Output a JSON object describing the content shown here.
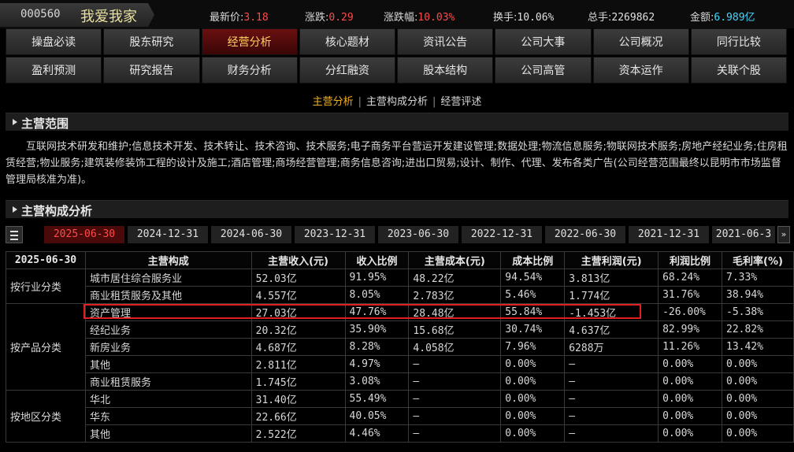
{
  "stock": {
    "code": "000560",
    "name": "我爱我家",
    "quotes": [
      {
        "label": "最新价:",
        "value": "3.18",
        "color": "red"
      },
      {
        "label": "涨跌:",
        "value": "0.29",
        "color": "red"
      },
      {
        "label": "涨跌幅:",
        "value": "10.03%",
        "color": "red"
      },
      {
        "label": "换手:",
        "value": "10.06%",
        "color": "wht"
      },
      {
        "label": "总手:",
        "value": "2269862",
        "color": "wht"
      },
      {
        "label": "金额:",
        "value": "6.989亿",
        "color": "cyan"
      }
    ]
  },
  "nav": {
    "row1": [
      "操盘必读",
      "股东研究",
      "经营分析",
      "核心题材",
      "资讯公告",
      "公司大事",
      "公司概况",
      "同行比较"
    ],
    "row2": [
      "盈利预测",
      "研究报告",
      "财务分析",
      "分红融资",
      "股本结构",
      "公司高管",
      "资本运作",
      "关联个股"
    ],
    "active": "经营分析"
  },
  "subnav": {
    "items": [
      "主营分析",
      "主营构成分析",
      "经营评述"
    ],
    "selected": "主营分析"
  },
  "section_scope": {
    "title": "主营范围",
    "text": "互联网技术研发和维护;信息技术开发、技术转让、技术咨询、技术服务;电子商务平台营运开发建设管理;数据处理;物流信息服务;物联网技术服务;房地产经纪业务;住房租赁经营;物业服务;建筑装修装饰工程的设计及施工;酒店管理;商场经营管理;商务信息咨询;进出口贸易;设计、制作、代理、发布各类广告(公司经营范围最终以昆明市市场监督管理局核准为准)。"
  },
  "section_comp": {
    "title": "主营构成分析"
  },
  "date_tabs": [
    "2025-06-30",
    "2024-12-31",
    "2024-06-30",
    "2023-12-31",
    "2023-06-30",
    "2022-12-31",
    "2022-06-30",
    "2021-12-31",
    "2021-06-3"
  ],
  "date_active": "2025-06-30",
  "more_glyph": "»",
  "table": {
    "headers": [
      "2025-06-30",
      "主营构成",
      "主营收入(元)",
      "收入比例",
      "主营成本(元)",
      "成本比例",
      "主营利润(元)",
      "利润比例",
      "毛利率(%)"
    ],
    "groups": [
      {
        "category": "按行业分类",
        "rows": [
          [
            "城市居住综合服务业",
            "52.03亿",
            "91.95%",
            "48.22亿",
            "94.54%",
            "3.813亿",
            "68.24%",
            "7.33%"
          ],
          [
            "商业租赁服务及其他",
            "4.557亿",
            "8.05%",
            "2.783亿",
            "5.46%",
            "1.774亿",
            "31.76%",
            "38.94%"
          ]
        ]
      },
      {
        "category": "按产品分类",
        "rows": [
          [
            "资产管理",
            "27.03亿",
            "47.76%",
            "28.48亿",
            "55.84%",
            "-1.453亿",
            "-26.00%",
            "-5.38%"
          ],
          [
            "经纪业务",
            "20.32亿",
            "35.90%",
            "15.68亿",
            "30.74%",
            "4.637亿",
            "82.99%",
            "22.82%"
          ],
          [
            "新房业务",
            "4.687亿",
            "8.28%",
            "4.058亿",
            "7.96%",
            "6288万",
            "11.26%",
            "13.42%"
          ],
          [
            "其他",
            "2.811亿",
            "4.97%",
            "—",
            "0.00%",
            "—",
            "0.00%",
            "0.00%"
          ],
          [
            "商业租赁服务",
            "1.745亿",
            "3.08%",
            "—",
            "0.00%",
            "—",
            "0.00%",
            "0.00%"
          ]
        ]
      },
      {
        "category": "按地区分类",
        "rows": [
          [
            "华北",
            "31.40亿",
            "55.49%",
            "—",
            "0.00%",
            "—",
            "0.00%",
            "0.00%"
          ],
          [
            "华东",
            "22.66亿",
            "40.05%",
            "—",
            "0.00%",
            "—",
            "0.00%",
            "0.00%"
          ],
          [
            "其他",
            "2.522亿",
            "4.46%",
            "—",
            "0.00%",
            "—",
            "0.00%",
            "0.00%"
          ]
        ]
      }
    ]
  },
  "colors": {
    "red": "#ff4a4a",
    "cyan": "#40d8ff",
    "active_nav": "#6a1010",
    "highlight_box": "#e02020"
  }
}
